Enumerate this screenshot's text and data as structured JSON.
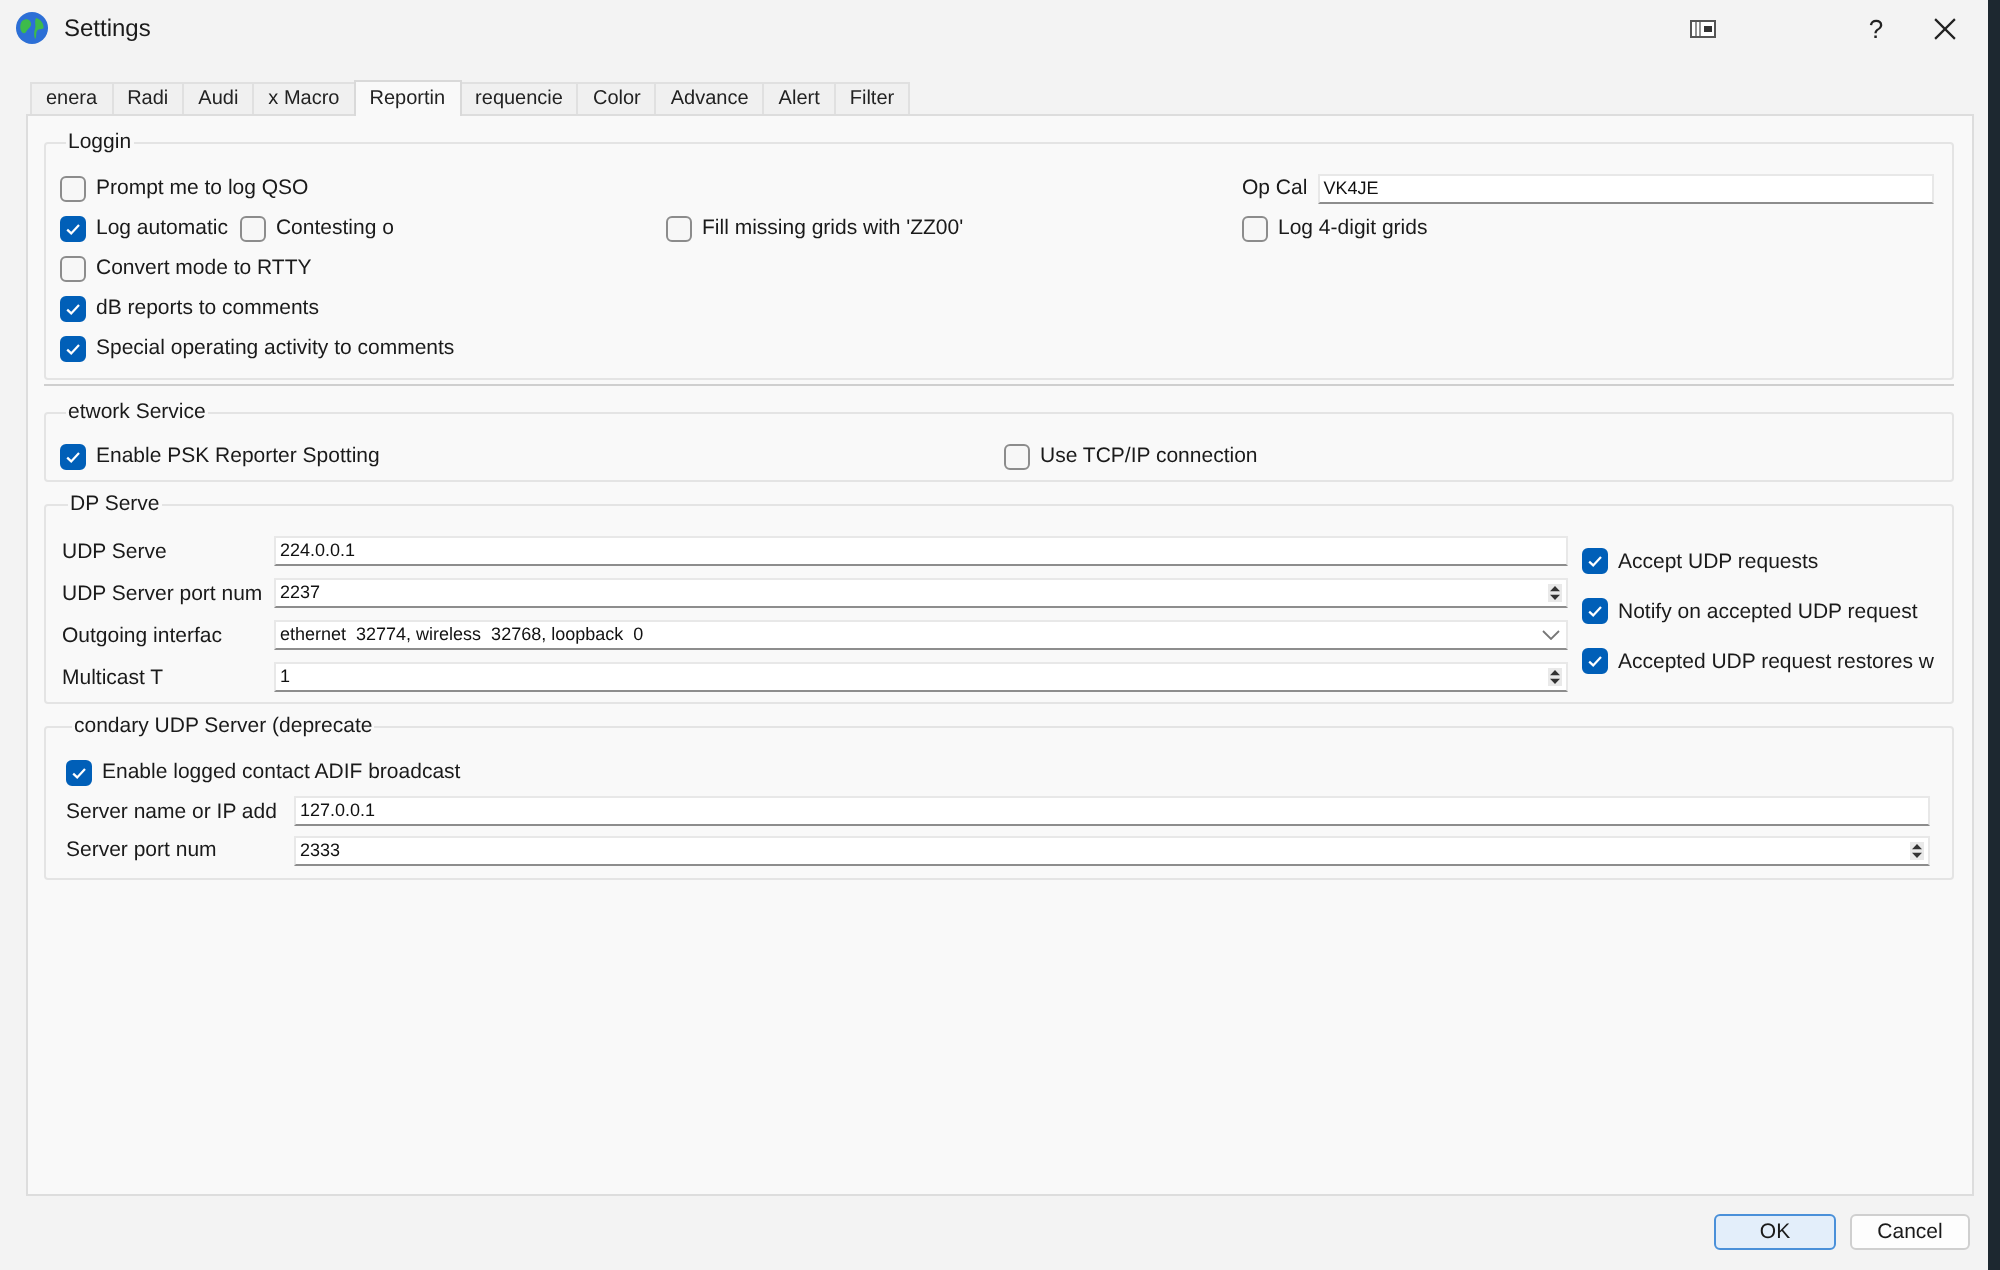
{
  "window": {
    "title": "Settings",
    "help_button": "?"
  },
  "tabs": [
    {
      "label": "enera",
      "selected": false
    },
    {
      "label": "Radi",
      "selected": false
    },
    {
      "label": "Audi",
      "selected": false
    },
    {
      "label": "x Macro",
      "selected": false
    },
    {
      "label": "Reportin",
      "selected": true
    },
    {
      "label": "requencie",
      "selected": false
    },
    {
      "label": "Color",
      "selected": false
    },
    {
      "label": "Advance",
      "selected": false
    },
    {
      "label": "Alert",
      "selected": false
    },
    {
      "label": "Filter",
      "selected": false
    }
  ],
  "logging": {
    "title": "Loggin",
    "rows": [
      [
        {
          "kind": "checkbox",
          "label": "Prompt me to log QSO",
          "checked": false
        },
        "",
        "",
        {
          "kind": "field",
          "label": "Op Cal",
          "value": "VK4JE"
        }
      ],
      [
        {
          "kind": "checkbox",
          "label": "Log automatic",
          "checked": true
        },
        {
          "kind": "checkbox",
          "label": "Contesting o",
          "checked": false
        },
        {
          "kind": "checkbox",
          "label": "Fill missing grids with 'ZZ00'",
          "checked": false
        },
        {
          "kind": "checkbox",
          "label": "Log 4-digit grids",
          "checked": false
        }
      ],
      [
        {
          "kind": "checkbox",
          "label": "Convert mode to RTTY",
          "checked": false
        }
      ],
      [
        {
          "kind": "checkbox",
          "label": "dB reports to comments",
          "checked": true
        }
      ],
      [
        {
          "kind": "checkbox",
          "label": "Special operating activity to comments",
          "checked": true
        }
      ]
    ]
  },
  "network_service": {
    "title": "etwork Service",
    "options": [
      {
        "label": "Enable PSK Reporter Spotting",
        "checked": true
      },
      {
        "label": "Use TCP/IP connection",
        "checked": false
      }
    ]
  },
  "udp_server": {
    "title": "DP Serve",
    "fields": [
      {
        "kind": "text",
        "label": "UDP Serve",
        "value": "224.0.0.1"
      },
      {
        "kind": "spin",
        "label": "UDP Server port num",
        "value": "2237"
      },
      {
        "kind": "combo",
        "label": "Outgoing interfac",
        "value": "ethernet  32774, wireless  32768, loopback  0"
      },
      {
        "kind": "spin",
        "label": "Multicast T",
        "value": "1"
      }
    ],
    "options": [
      {
        "label": "Accept UDP requests",
        "checked": true
      },
      {
        "label": "Notify on accepted UDP request",
        "checked": true
      },
      {
        "label": "Accepted UDP request restores w",
        "checked": true
      }
    ]
  },
  "secondary_udp_server": {
    "title": "condary UDP Server (deprecate",
    "options": [
      {
        "label": "Enable logged contact ADIF broadcast",
        "checked": true
      }
    ],
    "fields": [
      {
        "kind": "text",
        "label": "Server name or IP add",
        "value": "127.0.0.1"
      },
      {
        "kind": "spin",
        "label": "Server port num",
        "value": "2333"
      }
    ]
  },
  "buttons": [
    {
      "label": "OK",
      "default": true
    },
    {
      "label": "Cancel",
      "default": false
    }
  ]
}
